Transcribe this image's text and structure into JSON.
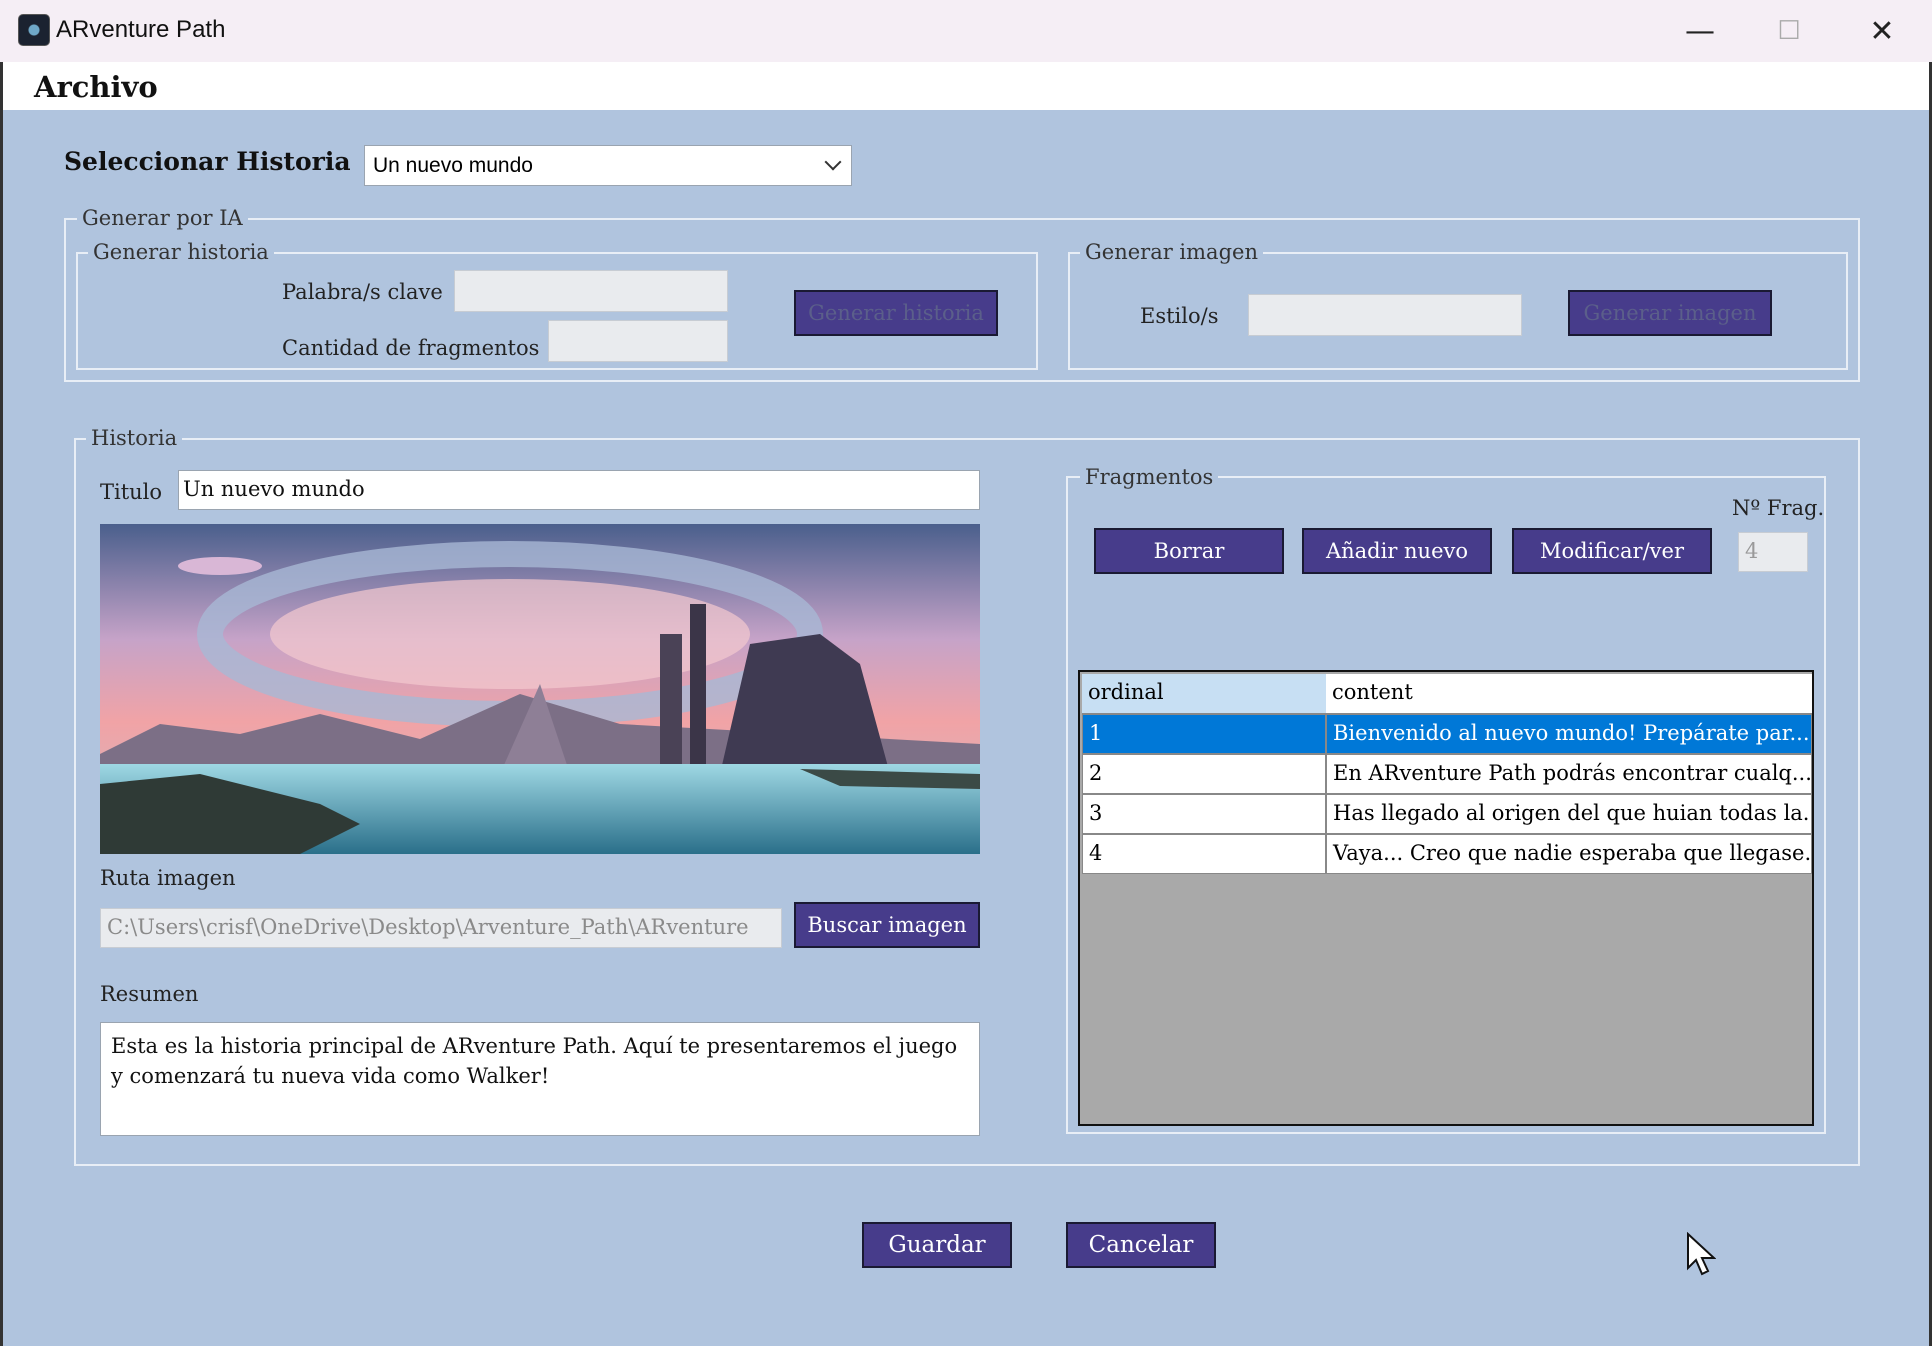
{
  "window": {
    "title": "ARventure Path",
    "min": "—",
    "max": "☐",
    "close": "✕"
  },
  "menu": {
    "archivo": "Archivo"
  },
  "select_story": {
    "label": "Seleccionar Historia",
    "value": "Un nuevo mundo"
  },
  "ia": {
    "legend": "Generar por IA",
    "historia": {
      "legend": "Generar historia",
      "keywords_label": "Palabra/s clave",
      "keywords_value": "",
      "count_label": "Cantidad de fragmentos",
      "count_value": "",
      "button": "Generar historia"
    },
    "imagen": {
      "legend": "Generar imagen",
      "style_label": "Estilo/s",
      "style_value": "",
      "button": "Generar imagen"
    }
  },
  "historia": {
    "legend": "Historia",
    "title_label": "Titulo",
    "title_value": "Un nuevo mundo",
    "image_path_label": "Ruta imagen",
    "image_path_value": "C:\\Users\\crisf\\OneDrive\\Desktop\\Arventure_Path\\ARventure",
    "search_image_button": "Buscar imagen",
    "summary_label": "Resumen",
    "summary_value": "Esta es la historia principal de ARventure Path. Aquí te presentaremos el juego y comenzará tu nueva vida como Walker!"
  },
  "fragmentos": {
    "legend": "Fragmentos",
    "n_frag_label": "Nº Frag.",
    "n_frag_value": "4",
    "buttons": {
      "delete": "Borrar",
      "add": "Añadir nuevo",
      "modify": "Modificar/ver"
    },
    "columns": [
      "ordinal",
      "content"
    ],
    "rows": [
      {
        "ordinal": "1",
        "content": "Bienvenido al nuevo mundo! Prepárate par..."
      },
      {
        "ordinal": "2",
        "content": "En ARventure Path podrás encontrar cualq..."
      },
      {
        "ordinal": "3",
        "content": "Has llegado al origen del que huian todas la..."
      },
      {
        "ordinal": "4",
        "content": "Vaya... Creo que nadie esperaba que llegase..."
      }
    ],
    "selected_row": 1
  },
  "footer": {
    "save": "Guardar",
    "cancel": "Cancelar"
  },
  "colors": {
    "background": "#b0c4de",
    "button": "#473c8b",
    "selection": "#0078d7"
  }
}
